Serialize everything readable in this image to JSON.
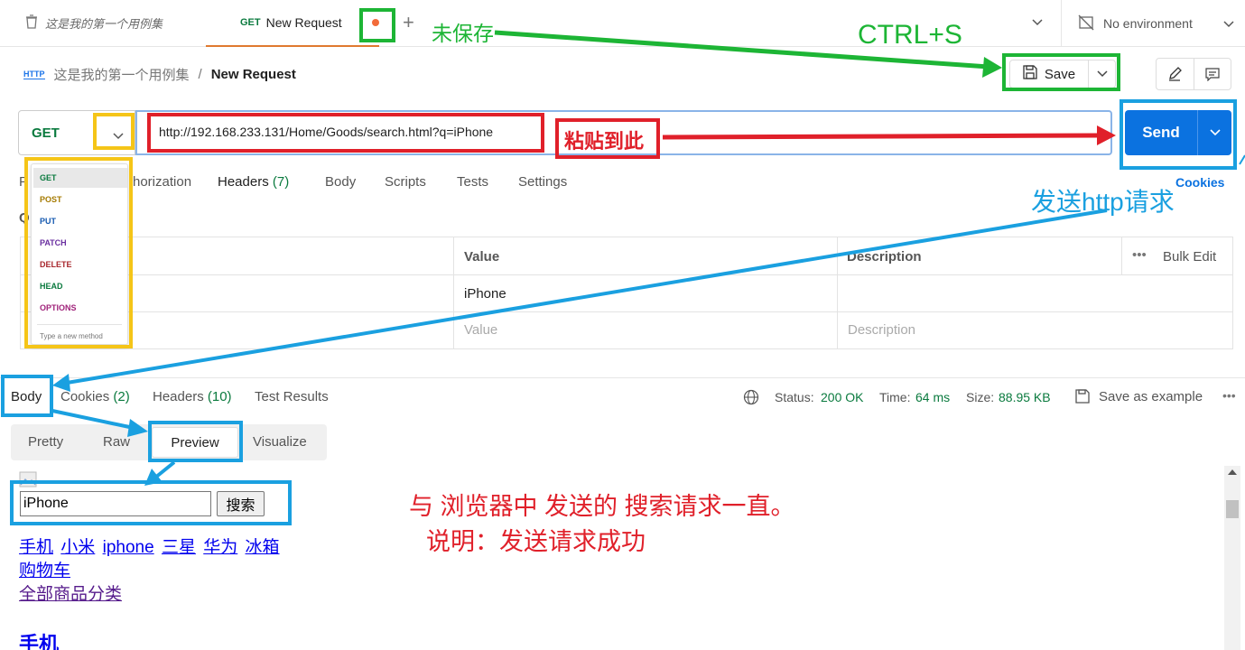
{
  "tabs": {
    "collection_tab": "这是我的第一个用例集",
    "request_tab_method": "GET",
    "request_tab_label": "New Request",
    "environment": "No environment"
  },
  "breadcrumb": {
    "icon": "HTTP",
    "parent": "这是我的第一个用例集",
    "separator": "/",
    "current": "New Request"
  },
  "toolbar": {
    "save_label": "Save"
  },
  "request": {
    "method": "GET",
    "url": "http://192.168.233.131/Home/Goods/search.html?q=iPhone",
    "send_label": "Send",
    "cookies_label": "Cookies"
  },
  "request_tabs": {
    "params_partial": "P",
    "auth_partial": "horization",
    "headers": "Headers",
    "headers_count": "(7)",
    "body": "Body",
    "scripts": "Scripts",
    "tests": "Tests",
    "settings": "Settings",
    "section_partial": "Q"
  },
  "params_table": {
    "col_value": "Value",
    "col_description": "Description",
    "bulk_edit": "Bulk Edit",
    "row1_value": "iPhone",
    "row2_value_placeholder": "Value",
    "row2_description_placeholder": "Description"
  },
  "method_dropdown": {
    "items": [
      "GET",
      "POST",
      "PUT",
      "PATCH",
      "DELETE",
      "HEAD",
      "OPTIONS"
    ],
    "hint": "Type a new method"
  },
  "response": {
    "tab_body": "Body",
    "tab_cookies": "Cookies",
    "tab_cookies_count": "(2)",
    "tab_headers": "Headers",
    "tab_headers_count": "(10)",
    "tab_test_results": "Test Results",
    "status_label": "Status:",
    "status_value": "200 OK",
    "time_label": "Time:",
    "time_value": "64 ms",
    "size_label": "Size:",
    "size_value": "88.95 KB",
    "save_example": "Save as example",
    "views": [
      "Pretty",
      "Raw",
      "Preview",
      "Visualize"
    ],
    "active_view": "Preview"
  },
  "preview": {
    "search_value": "iPhone",
    "search_button": "搜索",
    "links": [
      "手机",
      "小米",
      "iphone",
      "三星",
      "华为",
      "冰箱"
    ],
    "link_cart": "购物车",
    "link_all": "全部商品分类",
    "heading": "手机"
  },
  "annotations": {
    "unsaved": "未保存",
    "ctrl_s": "CTRL+S",
    "paste_here": "粘贴到此",
    "send_http": "发送http请求",
    "same_as_browser": "与 浏览器中 发送的 搜索请求一直。",
    "success": "说明：发送请求成功"
  },
  "colors": {
    "send_blue": "#0b72e0",
    "get_green": "#0a7a3e",
    "ann_green": "#1db535",
    "ann_red": "#e0202a",
    "ann_blue": "#1aa0e0",
    "ann_yellow": "#f5c518"
  }
}
